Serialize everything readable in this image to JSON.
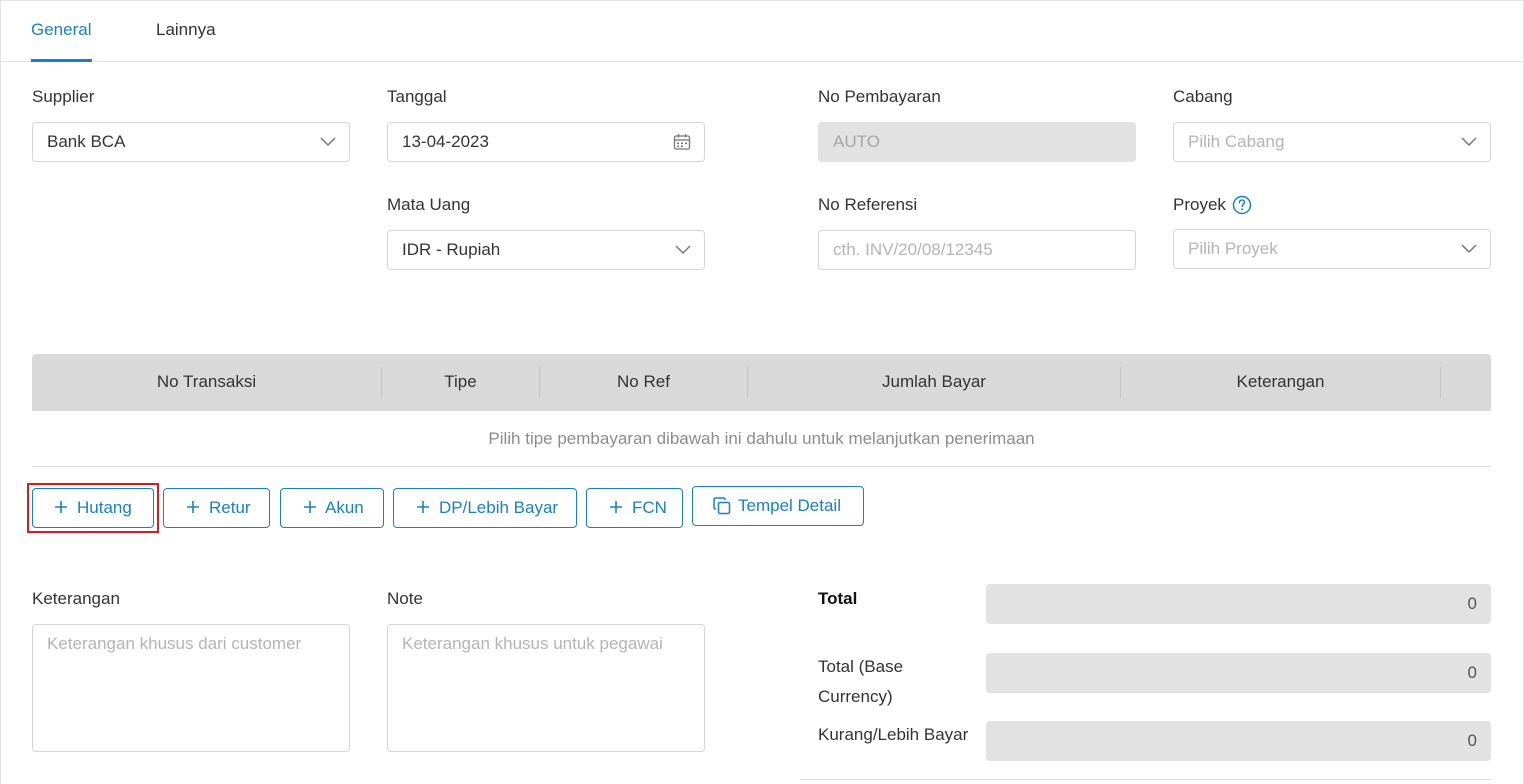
{
  "tabs": [
    {
      "label": "General",
      "active": true
    },
    {
      "label": "Lainnya",
      "active": false
    }
  ],
  "form": {
    "supplier": {
      "label": "Supplier",
      "value": "Bank BCA",
      "icon": "chevron-down-icon"
    },
    "tanggal": {
      "label": "Tanggal",
      "value": "13-04-2023",
      "icon": "calendar-icon"
    },
    "no_pembayaran": {
      "label": "No Pembayaran",
      "value": "AUTO"
    },
    "cabang": {
      "label": "Cabang",
      "placeholder": "Pilih Cabang",
      "icon": "chevron-down-icon"
    },
    "mata_uang": {
      "label": "Mata Uang",
      "value": "IDR - Rupiah",
      "icon": "chevron-down-icon"
    },
    "no_referensi": {
      "label": "No Referensi",
      "placeholder": "cth. INV/20/08/12345"
    },
    "proyek": {
      "label": "Proyek",
      "placeholder": "Pilih Proyek",
      "icon": "chevron-down-icon",
      "help_icon": "question-circle-icon"
    }
  },
  "table": {
    "columns": [
      "No Transaksi",
      "Tipe",
      "No Ref",
      "Jumlah Bayar",
      "Keterangan"
    ],
    "empty_message": "Pilih tipe pembayaran dibawah ini dahulu untuk melanjutkan penerimaan"
  },
  "buttons": {
    "hutang": "Hutang",
    "retur": "Retur",
    "akun": "Akun",
    "dp": "DP/Lebih Bayar",
    "fcn": "FCN",
    "tempel": "Tempel Detail"
  },
  "bottom": {
    "keterangan": {
      "label": "Keterangan",
      "placeholder": "Keterangan khusus dari customer"
    },
    "note": {
      "label": "Note",
      "placeholder": "Keterangan khusus untuk pegawai"
    },
    "total": {
      "label": "Total",
      "value": "0"
    },
    "total_base": {
      "label_line1": "Total (Base",
      "label_line2": "Currency)",
      "value": "0"
    },
    "kurang_lebih": {
      "label": "Kurang/Lebih Bayar",
      "value": "0"
    }
  },
  "colors": {
    "accent": "#1a7fc8",
    "highlight": "#d81c1c",
    "disabled_bg": "#e2e2e2",
    "table_header_bg": "#d9d9d9"
  }
}
